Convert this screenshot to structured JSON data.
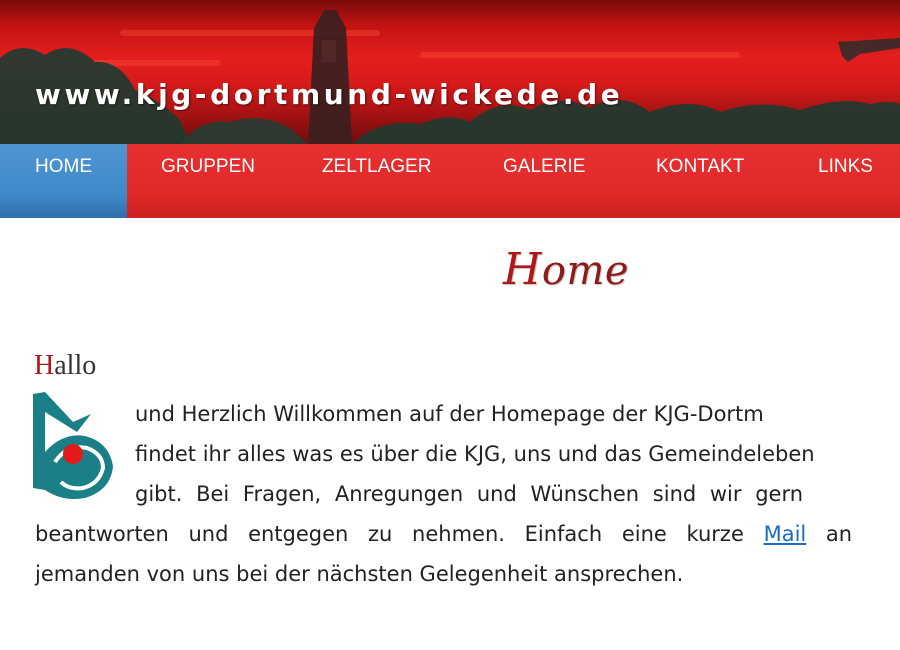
{
  "header": {
    "site_title": "www.kjg-dortmund-wickede.de"
  },
  "nav": {
    "items": [
      {
        "label": "HOME",
        "active": true
      },
      {
        "label": "GRUPPEN",
        "active": false
      },
      {
        "label": "ZELTLAGER",
        "active": false
      },
      {
        "label": "GALERIE",
        "active": false
      },
      {
        "label": "KONTAKT",
        "active": false
      },
      {
        "label": "LINKS",
        "active": false
      }
    ]
  },
  "main": {
    "page_title_initial": "H",
    "page_title_rest": "ome",
    "greeting_initial": "H",
    "greeting_rest": "allo",
    "lines": [
      "und Herzlich Willkommen auf der Homepage der KJG-Dortm",
      "findet ihr alles was es über die KJG, uns und das Gemeindeleben",
      "gibt. Bei Fragen, Anregungen und Wünschen sind wir gern",
      "beantworten und entgegen zu nehmen. Einfach eine kurze",
      "jemanden von uns bei der nächsten Gelegenheit ansprechen."
    ],
    "mail_link": "Mail",
    "line4_tail": "an"
  },
  "colors": {
    "nav_red": "#e02828",
    "nav_active_blue": "#4f97d3",
    "title_red": "#8e1a1a",
    "logo_teal": "#1a7f86",
    "logo_dot": "#e21a1a",
    "link_blue": "#1a6ac8"
  }
}
